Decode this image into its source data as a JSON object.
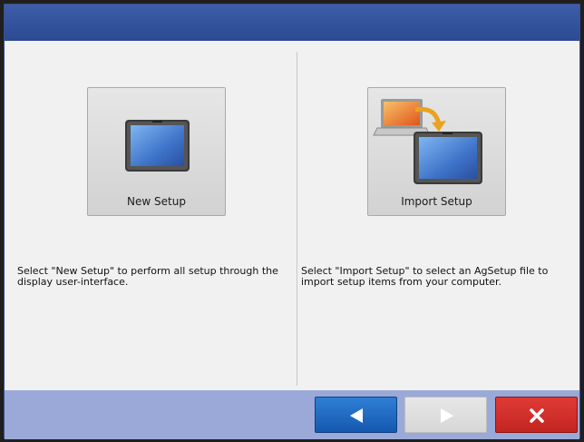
{
  "new_setup": {
    "label": "New Setup",
    "description": "Select \"New Setup\" to perform all setup through the display user-interface.",
    "icon": "display-icon"
  },
  "import_setup": {
    "label": "Import Setup",
    "description": "Select \"Import Setup\" to select an AgSetup file to import setup items from your computer.",
    "icon": "import-from-computer-icon"
  },
  "footer": {
    "back_icon": "arrow-left-icon",
    "next_icon": "arrow-right-icon",
    "cancel_icon": "close-icon"
  },
  "colors": {
    "title_bar": "#2c4a93",
    "footer": "#9aa9d8",
    "back_button": "#1a66c2",
    "cancel_button": "#d0302c",
    "next_button_disabled": "#dedede"
  }
}
